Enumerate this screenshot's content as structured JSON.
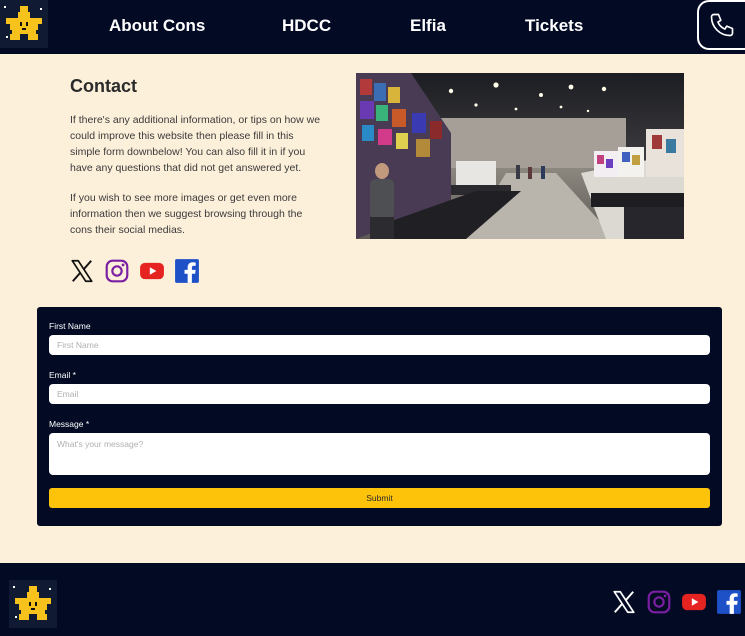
{
  "header": {
    "logo_icon": "pixel-star-icon",
    "nav": [
      {
        "label": "About Cons"
      },
      {
        "label": "HDCC"
      },
      {
        "label": "Elfia"
      },
      {
        "label": "Tickets"
      }
    ],
    "phone_icon": "phone-icon"
  },
  "contact": {
    "title": "Contact",
    "paragraph1": "If there's any additional information, or tips on how we could improve this website then please fill in this simple form downbelow! You can also fill it in if you have any questions that did not get answered yet.",
    "paragraph2": "If you wish to see more images or get even more information then we suggest browsing through the cons their social medias.",
    "social_icons": [
      "x-icon",
      "instagram-icon",
      "youtube-icon",
      "facebook-icon"
    ]
  },
  "form": {
    "first_name_label": "First Name",
    "first_name_placeholder": "First Name",
    "email_label": "Email *",
    "email_placeholder": "Email",
    "message_label": "Message *",
    "message_placeholder": "What's your message?",
    "submit_label": "Submit"
  },
  "footer": {
    "logo_icon": "pixel-star-icon",
    "social_icons": [
      "x-icon",
      "instagram-icon",
      "youtube-icon",
      "facebook-icon"
    ]
  },
  "colors": {
    "navy": "#030a24",
    "cream": "#fdf0da",
    "submit_yellow": "#fcc30a",
    "instagram_purple": "#7a1fa2",
    "youtube_red": "#e52421",
    "facebook_blue": "#1e50c8"
  }
}
